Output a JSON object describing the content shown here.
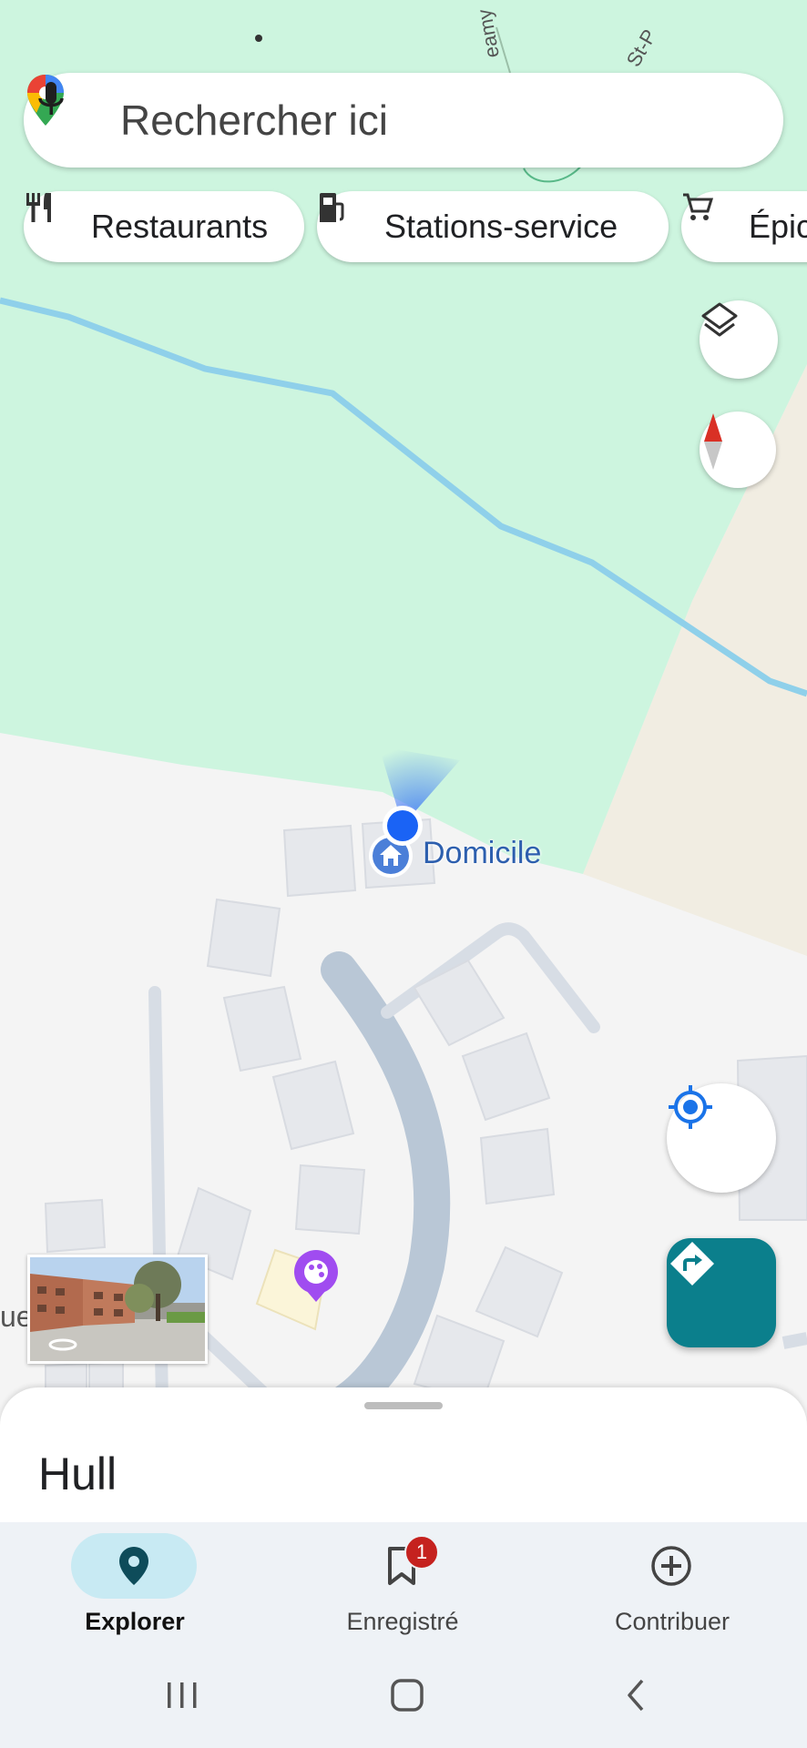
{
  "search": {
    "placeholder": "Rechercher ici"
  },
  "chips": [
    {
      "label": "Restaurants",
      "icon": "restaurant-icon"
    },
    {
      "label": "Stations-service",
      "icon": "gas-station-icon"
    },
    {
      "label": "Épic",
      "icon": "cart-icon"
    }
  ],
  "map": {
    "home_label": "Domicile",
    "edge_label": "ue",
    "trail_label_1": "eamy",
    "trail_label_2": "St-P"
  },
  "sheet": {
    "place_name": "Hull"
  },
  "bottom_nav": [
    {
      "label": "Explorer",
      "icon": "explore-pin-icon",
      "active": true
    },
    {
      "label": "Enregistré",
      "icon": "bookmark-icon",
      "badge": "1"
    },
    {
      "label": "Contribuer",
      "icon": "add-circle-icon"
    }
  ],
  "colors": {
    "park": "#cdf5df",
    "water": "#8fd0ea",
    "accent": "#0b7f8c",
    "location": "#1a63f5",
    "badge": "#c5221f"
  }
}
